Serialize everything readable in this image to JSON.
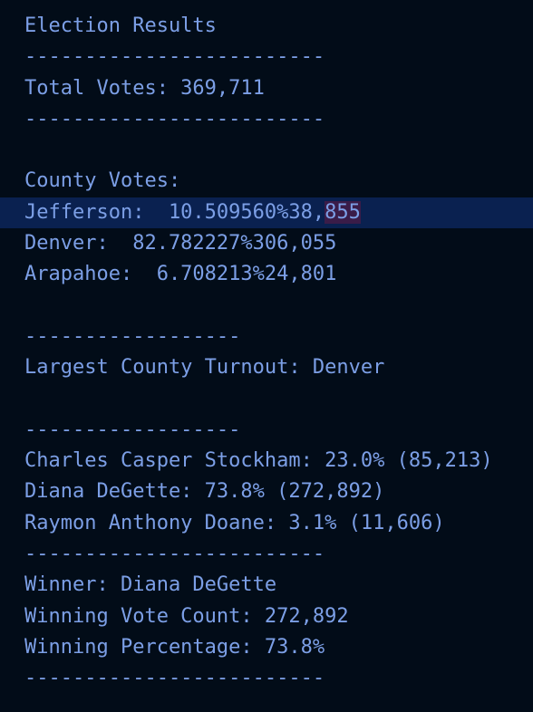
{
  "report": {
    "title": "Election Results",
    "sep_long": "-------------------------",
    "sep_short": "------------------",
    "total_votes": "Total Votes: 369,711",
    "county_header": "County Votes:",
    "counties": [
      {
        "before_sel": "Jefferson:  10.509560%38,",
        "sel": "855",
        "text": "Jefferson:  10.509560%38,855"
      },
      {
        "text": "Denver:  82.782227%306,055"
      },
      {
        "text": "Arapahoe:  6.708213%24,801"
      }
    ],
    "largest_county": "Largest County Turnout: Denver",
    "candidates": [
      "Charles Casper Stockham: 23.0% (85,213)",
      "Diana DeGette: 73.8% (272,892)",
      "Raymon Anthony Doane: 3.1% (11,606)"
    ],
    "winner": "Winner: Diana DeGette",
    "winning_vote_count": "Winning Vote Count: 272,892",
    "winning_percentage": "Winning Percentage: 73.8%"
  },
  "colors": {
    "background": "#020c18",
    "text": "#7c9fe6",
    "current_line": "#0a2150",
    "selection": "#3a1c48"
  }
}
